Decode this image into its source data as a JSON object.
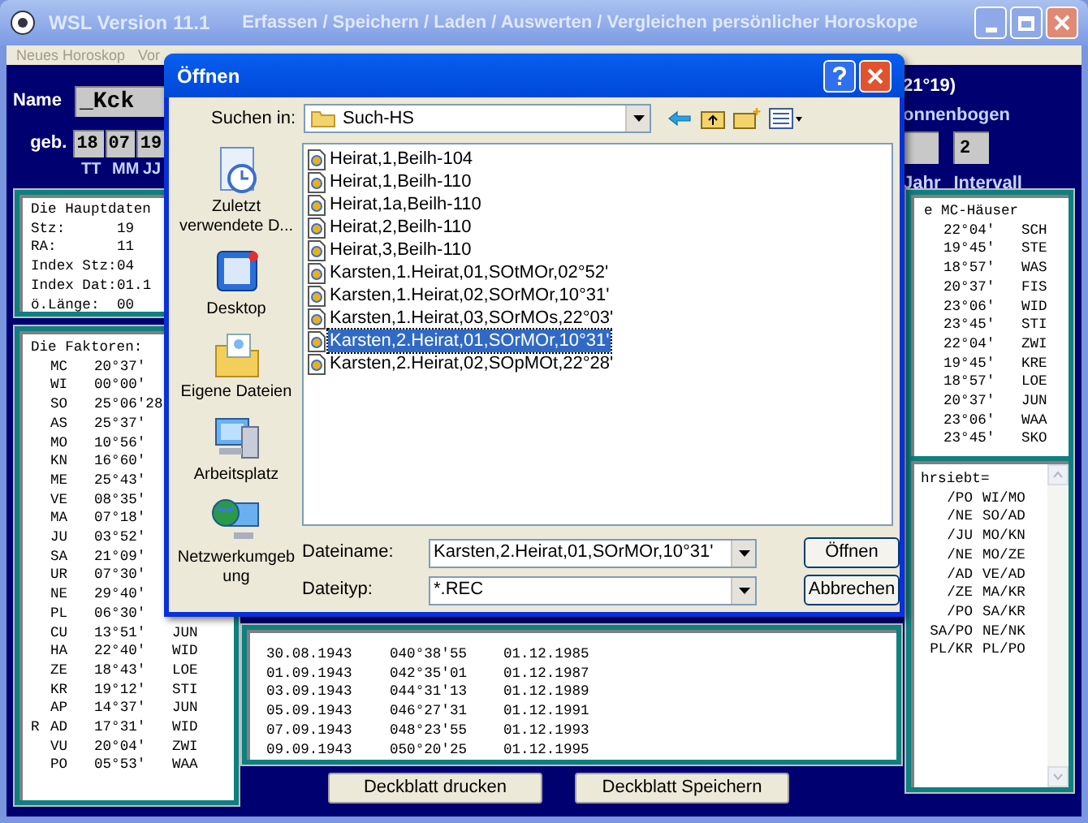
{
  "window": {
    "title": "WSL Version 11.1",
    "subtitle": "Erfassen / Speichern / Laden / Auswerten / Vergleichen persönlicher Horoskope"
  },
  "menu": [
    {
      "label": "Neues Horoskop"
    },
    {
      "label": "Vor"
    }
  ],
  "person": {
    "name_label": "Name",
    "name": "_Kck",
    "born_label": "geb.",
    "date_fields": [
      "18",
      "07",
      "19"
    ],
    "date_labels": [
      "TT",
      "MM",
      "JJ"
    ]
  },
  "solar_arc": {
    "value": "21°19)",
    "label": "onnenbogen",
    "fields": [
      {
        "label": "Jahr"
      },
      {
        "label": "Intervall",
        "value": "2"
      }
    ]
  },
  "main_data": {
    "title": "Die Hauptdaten",
    "rows": [
      {
        "label": "Stz:",
        "value": "19"
      },
      {
        "label": "RA:",
        "value": "11"
      },
      {
        "label": "Index Stz:",
        "value": "04"
      },
      {
        "label": "Index Dat:",
        "value": "01.1"
      },
      {
        "label": "ö.Länge:",
        "value": "00"
      }
    ]
  },
  "factors": {
    "title": "Die Faktoren:",
    "rows": [
      {
        "name": "MC",
        "value": "20°37'"
      },
      {
        "name": "WI",
        "value": "00°00'"
      },
      {
        "name": "SO",
        "value": "25°06'28"
      },
      {
        "name": "AS",
        "value": "25°37'"
      },
      {
        "name": "MO",
        "value": "10°56'"
      },
      {
        "name": "KN",
        "value": "16°60'"
      },
      {
        "name": "ME",
        "value": "25°43'"
      },
      {
        "name": "VE",
        "value": "08°35'"
      },
      {
        "name": "MA",
        "value": "07°18'"
      },
      {
        "name": "JU",
        "value": "03°52'"
      },
      {
        "name": "SA",
        "value": "21°09'"
      },
      {
        "name": "UR",
        "value": "07°30'"
      },
      {
        "name": "NE",
        "value": "29°40'"
      },
      {
        "name": "PL",
        "value": "06°30'"
      },
      {
        "name": "CU",
        "value": "13°51'",
        "sign": "JUN"
      },
      {
        "name": "HA",
        "value": "22°40'",
        "sign": "WID"
      },
      {
        "name": "ZE",
        "value": "18°43'",
        "sign": "LOE"
      },
      {
        "name": "KR",
        "value": "19°12'",
        "sign": "STI"
      },
      {
        "name": "AP",
        "value": "14°37'",
        "sign": "JUN"
      },
      {
        "prefix": "R",
        "name": "AD",
        "value": "17°31'",
        "sign": "WID"
      },
      {
        "name": "VU",
        "value": "20°04'",
        "sign": "ZWI"
      },
      {
        "name": "PO",
        "value": "05°53'",
        "sign": "WAA"
      }
    ]
  },
  "progressions": {
    "rows": [
      [
        "30.08.1943",
        "040°38'55",
        "01.12.1985"
      ],
      [
        "01.09.1943",
        "042°35'01",
        "01.12.1987"
      ],
      [
        "03.09.1943",
        "044°31'13",
        "01.12.1989"
      ],
      [
        "05.09.1943",
        "046°27'31",
        "01.12.1991"
      ],
      [
        "07.09.1943",
        "048°23'55",
        "01.12.1993"
      ],
      [
        "09.09.1943",
        "050°20'25",
        "01.12.1995"
      ]
    ]
  },
  "buttons": [
    "Deckblatt drucken",
    "Deckblatt Speichern"
  ],
  "mc_houses": {
    "title": "e MC-Häuser",
    "rows": [
      {
        "value": "22°04'",
        "sign": "SCH"
      },
      {
        "value": "19°45'",
        "sign": "STE"
      },
      {
        "value": "18°57'",
        "sign": "WAS"
      },
      {
        "value": "20°37'",
        "sign": "FIS"
      },
      {
        "value": "23°06'",
        "sign": "WID"
      },
      {
        "value": "23°45'",
        "sign": "STI"
      },
      {
        "value": "22°04'",
        "sign": "ZWI"
      },
      {
        "value": "19°45'",
        "sign": "KRE"
      },
      {
        "value": "18°57'",
        "sign": "LOE"
      },
      {
        "value": "20°37'",
        "sign": "JUN"
      },
      {
        "value": "23°06'",
        "sign": "WAA"
      },
      {
        "value": "23°45'",
        "sign": "SKO"
      }
    ]
  },
  "midpoints": {
    "title": "hrsiebt=",
    "rows": [
      [
        "/PO",
        "WI/MO"
      ],
      [
        "/NE",
        "SO/AD"
      ],
      [
        "/JU",
        "MO/KN"
      ],
      [
        "/NE",
        "MO/ZE"
      ],
      [
        "/AD",
        "VE/AD"
      ],
      [
        "/ZE",
        "MA/KR"
      ],
      [
        "/PO",
        "SA/KR"
      ],
      [
        "SA/PO",
        "NE/NK"
      ],
      [
        "PL/KR",
        "PL/PO"
      ]
    ]
  },
  "dialog": {
    "title": "Öffnen",
    "look_in_label": "Suchen in:",
    "look_in": "Such-HS",
    "places": [
      {
        "kind": "recent",
        "label": "Zuletzt verwendete D..."
      },
      {
        "kind": "desktop",
        "label": "Desktop"
      },
      {
        "kind": "documents",
        "label": "Eigene Dateien"
      },
      {
        "kind": "computer",
        "label": "Arbeitsplatz"
      },
      {
        "kind": "network",
        "label": "Netzwerkumgebung"
      }
    ],
    "files": [
      {
        "name": "Heirat,1,Beilh-104",
        "selected": false
      },
      {
        "name": "Heirat,1,Beilh-110",
        "selected": false
      },
      {
        "name": "Heirat,1a,Beilh-110",
        "selected": false
      },
      {
        "name": "Heirat,2,Beilh-110",
        "selected": false
      },
      {
        "name": "Heirat,3,Beilh-110",
        "selected": false
      },
      {
        "name": "Karsten,1.Heirat,01,SOtMOr,02°52'",
        "selected": false
      },
      {
        "name": "Karsten,1.Heirat,02,SOrMOr,10°31'",
        "selected": false
      },
      {
        "name": "Karsten,1.Heirat,03,SOrMOs,22°03'",
        "selected": false
      },
      {
        "name": "Karsten,2.Heirat,01,SOrMOr,10°31'",
        "selected": true
      },
      {
        "name": "Karsten,2.Heirat,02,SOpMOt,22°28'",
        "selected": false
      }
    ],
    "filename_label": "Dateiname:",
    "filename": "Karsten,2.Heirat,01,SOrMOr,10°31'",
    "filetype_label": "Dateityp:",
    "filetype": "*.REC",
    "buttons": [
      "Öffnen",
      "Abbrechen"
    ]
  }
}
